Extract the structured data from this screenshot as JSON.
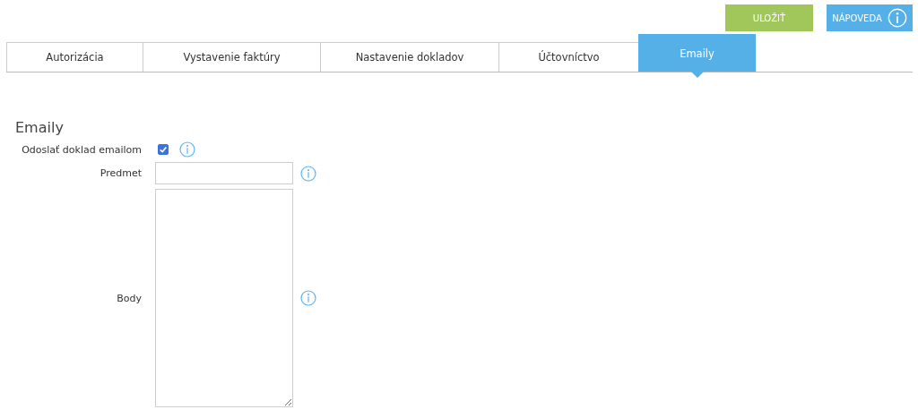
{
  "toolbar": {
    "buttons": [
      {
        "label": "ULOŽIŤ",
        "kind": "save"
      },
      {
        "label": "NÁPOVEDA",
        "kind": "help"
      }
    ]
  },
  "tabs": [
    {
      "label": "Autorizácia",
      "selected": false
    },
    {
      "label": "Vystavenie faktúry",
      "selected": false
    },
    {
      "label": "Nastavenie dokladov",
      "selected": false
    },
    {
      "label": "Účtovníctvo",
      "selected": false
    },
    {
      "label": "Emaily",
      "selected": true
    }
  ],
  "section": {
    "title": "Emaily"
  },
  "fields": [
    {
      "label": "Odoslať doklad emailom",
      "kind": "checkbox",
      "checked": true
    },
    {
      "label": "Predmet",
      "kind": "text"
    },
    {
      "label": "Body",
      "kind": "textarea"
    }
  ]
}
